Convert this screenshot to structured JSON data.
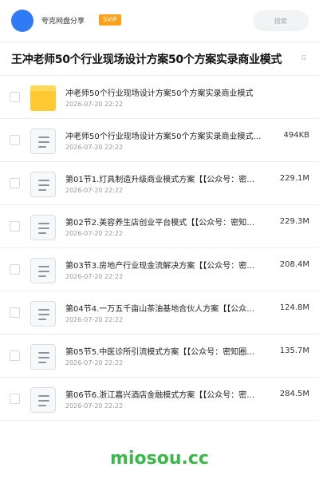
{
  "header": {
    "brand": "夸克网盘分享",
    "badge": "SVIP",
    "search_placeholder": "搜索"
  },
  "page_title": "王冲老师50个行业现场设计方案50个方案实录商业模式",
  "page_title_fade": "G",
  "files": [
    {
      "type": "folder",
      "name": "冲老师50个行业现场设计方案50个方案实录商业模式",
      "date": "2026-07-20 22:22",
      "size": ""
    },
    {
      "type": "document",
      "name": "冲老师50个行业现场设计方案50个方案实录商业模式…",
      "date": "2026-07-20 22:22",
      "size": "494KB"
    },
    {
      "type": "document",
      "name": "第01节1.灯具制造升级商业模式方案【【公众号：密…",
      "date": "2026-07-20 22:22",
      "size": "229.1M"
    },
    {
      "type": "document",
      "name": "第02节2.美容养生店创业平台模式【【公众号：密知…",
      "date": "2026-07-20 22:22",
      "size": "229.3M"
    },
    {
      "type": "document",
      "name": "第03节3.房地产行业现金流解决方案【【公众号：密…",
      "date": "2026-07-20 22:22",
      "size": "208.4M"
    },
    {
      "type": "document",
      "name": "第04节4.一万五千亩山茶油基地合伙人方案【【公众…",
      "date": "2026-07-20 22:22",
      "size": "124.8M"
    },
    {
      "type": "document",
      "name": "第05节5.中医诊所引流模式方案【【公众号：密知圈…",
      "date": "2026-07-20 22:22",
      "size": "135.7M"
    },
    {
      "type": "document",
      "name": "第06节6.浙江嘉兴酒店金融模式方案【【公众号：密…",
      "date": "2026-07-20 22:22",
      "size": "284.5M"
    }
  ],
  "watermark": "miosou.cc",
  "colors": {
    "avatar": "#2f7bf6",
    "badge": "#ff9f1a",
    "folder": "#ffc933",
    "watermark": "#3cb84a"
  }
}
